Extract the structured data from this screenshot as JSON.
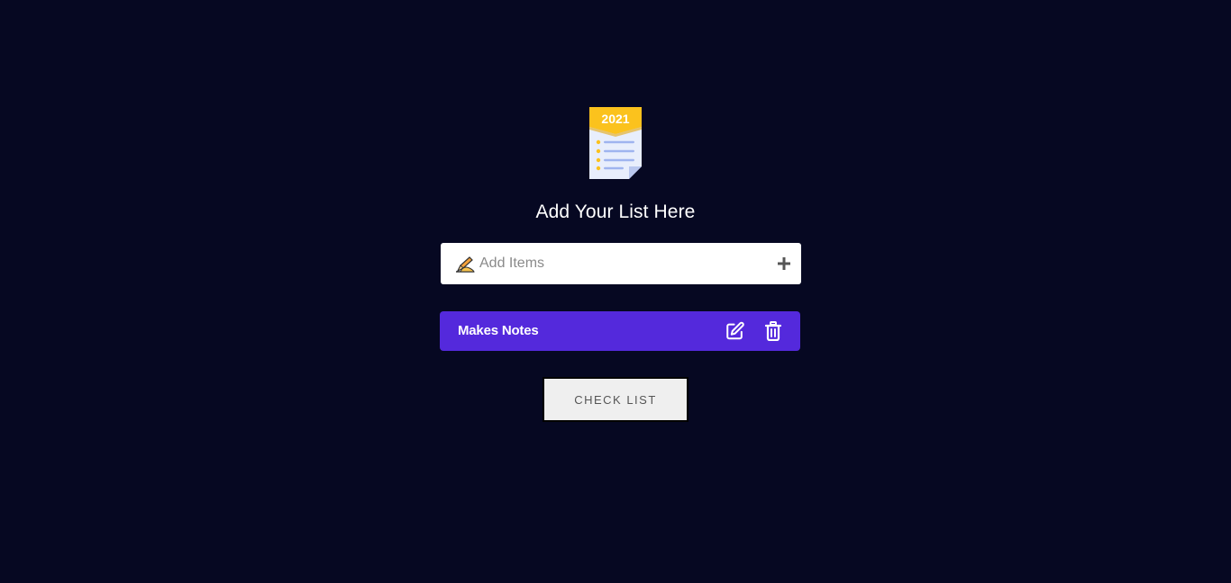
{
  "logo": {
    "year": "2021",
    "icon": "checklist-document-icon"
  },
  "heading": "Add Your List Here",
  "input": {
    "placeholder": "Add Items",
    "value": "",
    "prefix_icon": "writing-hand-icon",
    "add_icon": "plus-icon"
  },
  "items": [
    {
      "label": "Makes Notes",
      "edit_icon": "edit-icon",
      "delete_icon": "trash-icon"
    }
  ],
  "check_button_label": "Check List",
  "colors": {
    "background": "#060822",
    "item_bg": "#5429dc",
    "button_bg": "#efefef",
    "logo_accent": "#fbc21d"
  }
}
